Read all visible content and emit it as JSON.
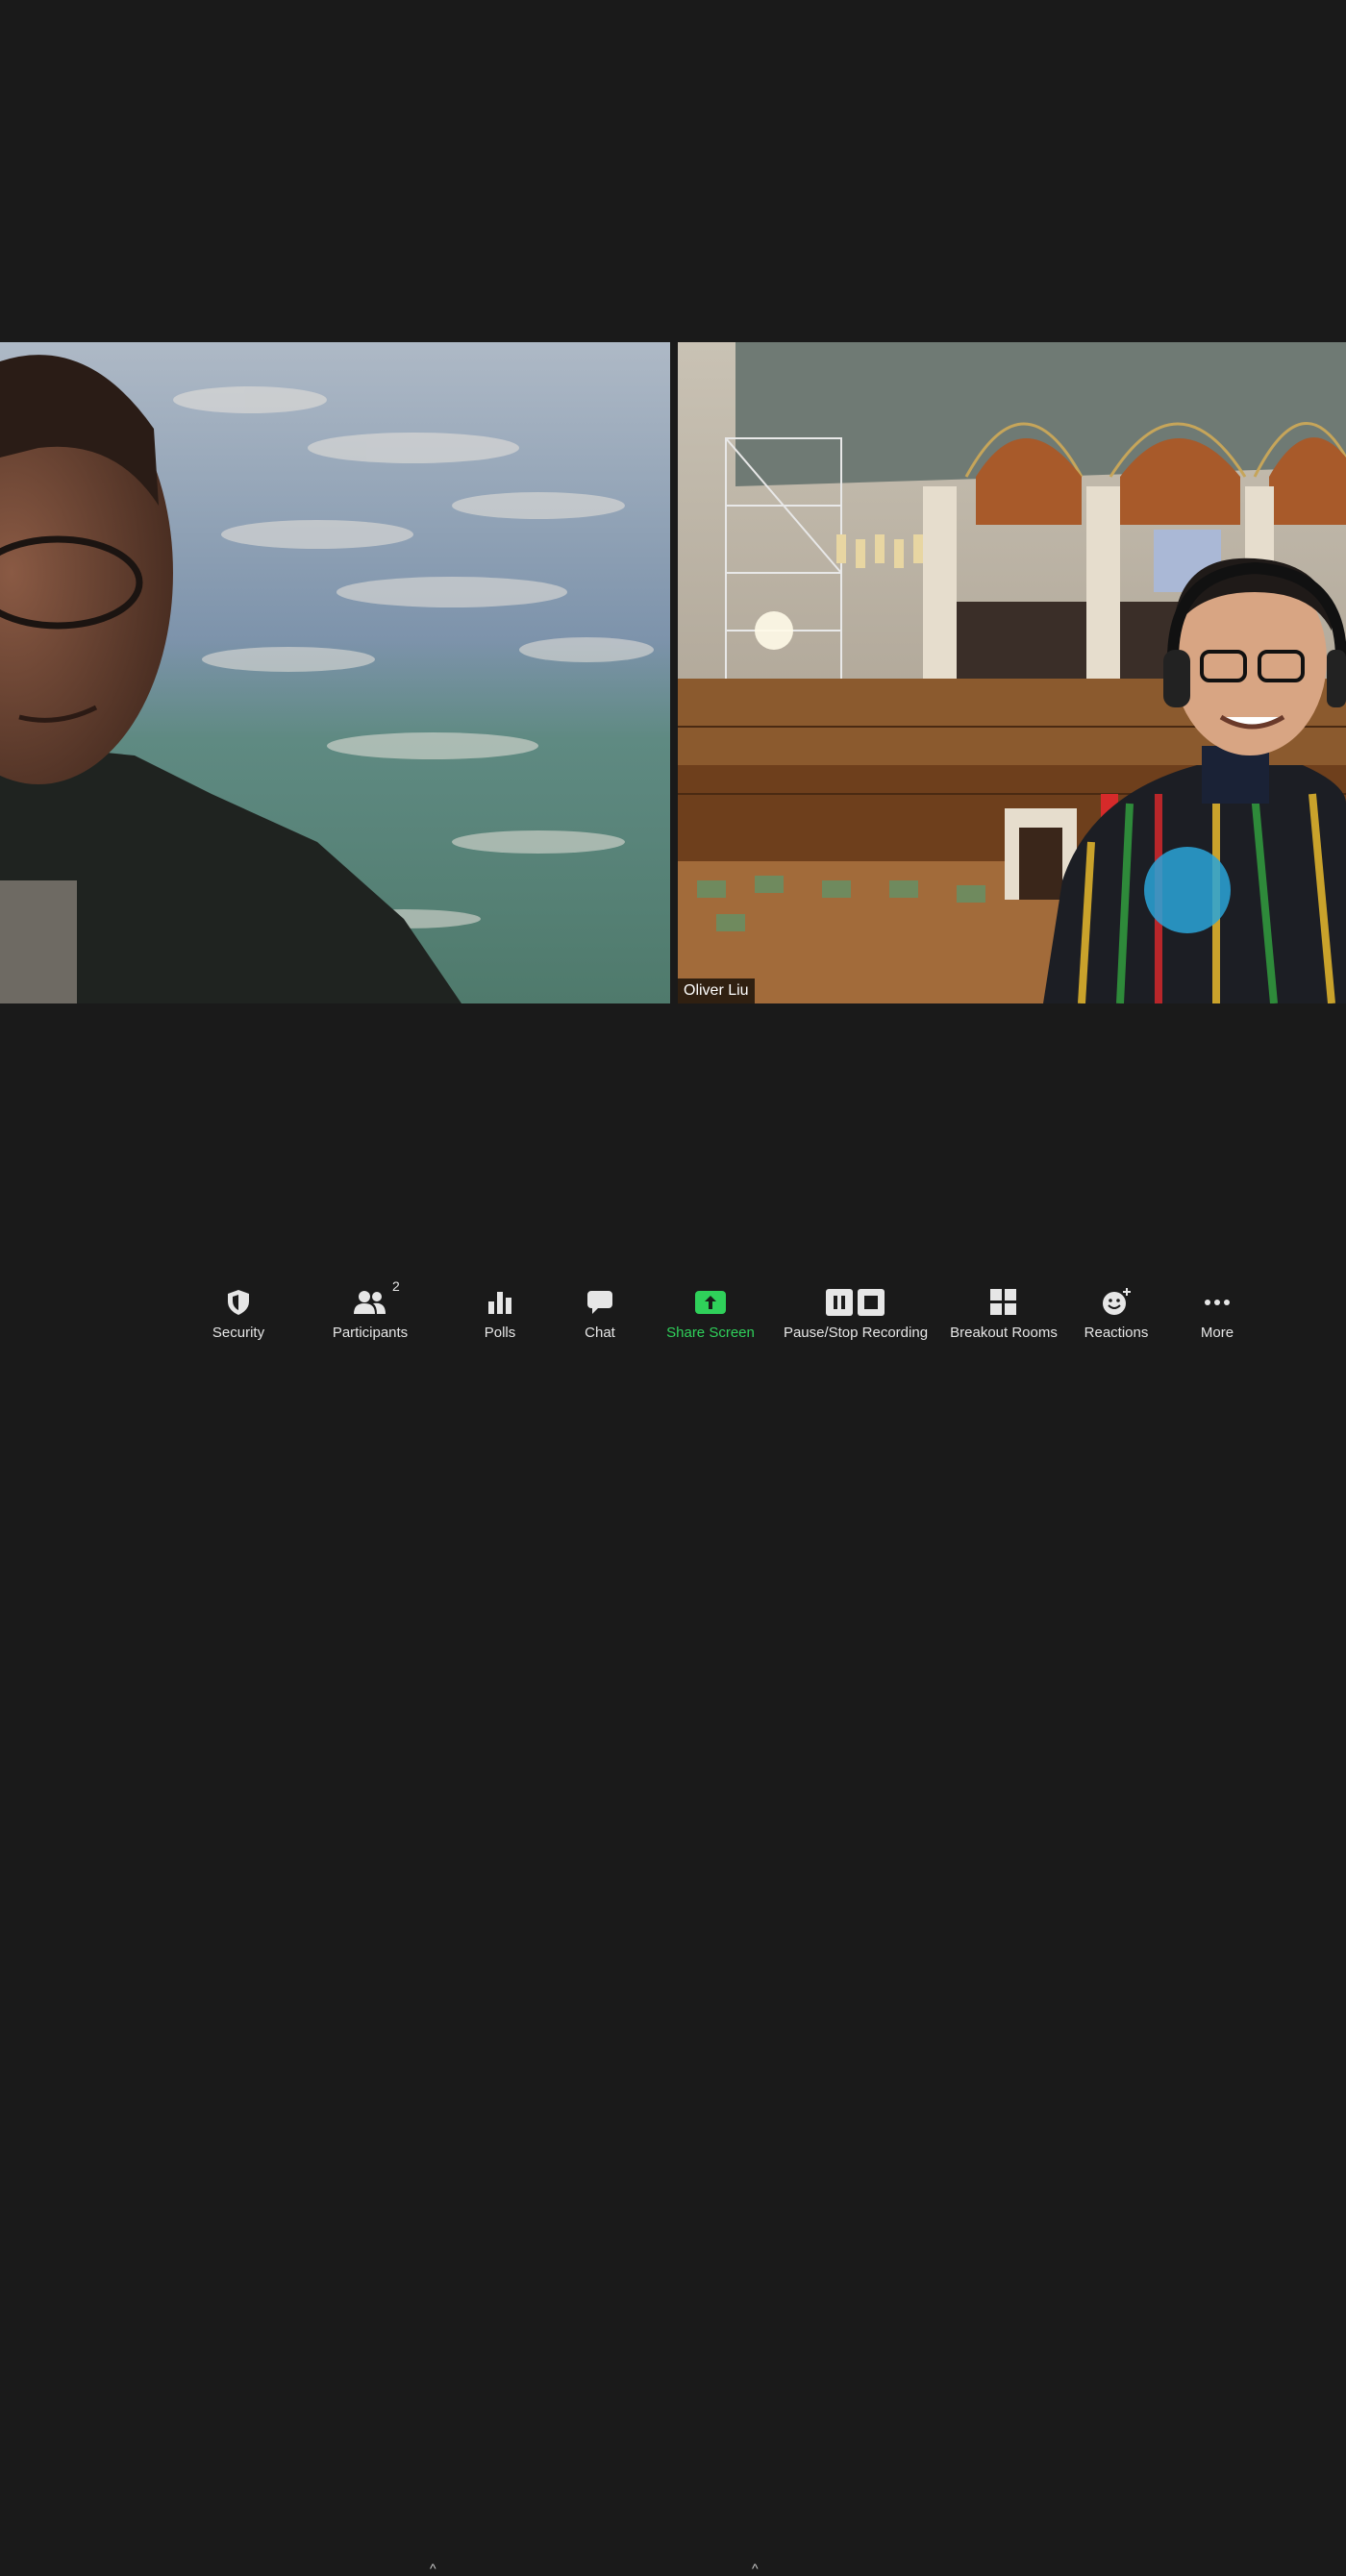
{
  "participants_tiles": [
    {
      "name": ""
    },
    {
      "name": "Oliver Liu"
    }
  ],
  "toolbar": {
    "security": {
      "label": "Security",
      "icon": "shield-icon"
    },
    "participants": {
      "label": "Participants",
      "count": "2",
      "icon": "people-icon"
    },
    "polls": {
      "label": "Polls",
      "icon": "bar-chart-icon"
    },
    "chat": {
      "label": "Chat",
      "icon": "chat-bubble-icon"
    },
    "share_screen": {
      "label": "Share Screen",
      "icon": "share-arrow-icon",
      "color": "#2fd05a"
    },
    "recording": {
      "label": "Pause/Stop Recording",
      "icon": "pause-stop-icon"
    },
    "breakout": {
      "label": "Breakout Rooms",
      "icon": "grid-icon"
    },
    "reactions": {
      "label": "Reactions",
      "icon": "smiley-plus-icon"
    },
    "more": {
      "label": "More",
      "icon": "ellipsis-icon"
    },
    "caret_glyph": "^"
  },
  "colors": {
    "background": "#1a1a1a",
    "accent_green": "#2fd05a"
  }
}
